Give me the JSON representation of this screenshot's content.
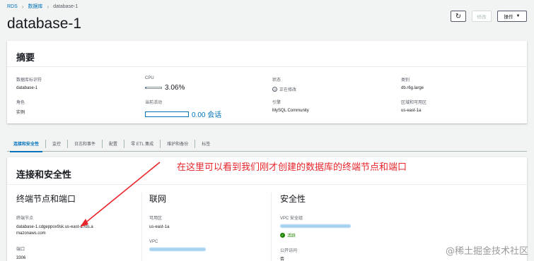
{
  "breadcrumb": {
    "root": "RDS",
    "section": "数据库",
    "current": "database-1"
  },
  "page": {
    "title": "database-1"
  },
  "toolbar": {
    "refresh_glyph": "↻",
    "modify_label": "修改",
    "actions_label": "操作",
    "actions_caret": "▼"
  },
  "summary": {
    "title": "摘要",
    "db_identifier": {
      "label": "数据库标识符",
      "value": "database-1"
    },
    "cpu": {
      "label": "CPU",
      "value": "3.06%",
      "fraction": 0.0306
    },
    "status": {
      "label": "状态",
      "value": "正在修改"
    },
    "class": {
      "label": "类别",
      "value": "db.r6g.large"
    },
    "role": {
      "label": "角色",
      "value": "实例"
    },
    "connections": {
      "label": "当前活动",
      "value": "0.00 会话"
    },
    "engine": {
      "label": "引擎",
      "value": "MySQL Community"
    },
    "region_az": {
      "label": "区域和可用区",
      "value": "us-east-1a"
    }
  },
  "tabs": [
    {
      "label": "连接和安全性",
      "active": true
    },
    {
      "label": "监控"
    },
    {
      "label": "日志和事件"
    },
    {
      "label": "配置"
    },
    {
      "label": "零 ETL 集成"
    },
    {
      "label": "维护和备份"
    },
    {
      "label": "标签"
    }
  ],
  "connectivity": {
    "title": "连接和安全性",
    "endpoint_section": {
      "heading": "终端节点和端口",
      "endpoint_label": "终端节点",
      "endpoint_value": "database-1.cdgeppox9sk.us-east-1.rds.amazonaws.com",
      "port_label": "端口",
      "port_value": "3306"
    },
    "network_section": {
      "heading": "联网",
      "az_label": "可用区",
      "az_value": "us-east-1a",
      "vpc_label": "VPC"
    },
    "security_section": {
      "heading": "安全性",
      "sg_label": "VPC 安全组",
      "sg_status": "活跃",
      "public_label": "公开访问",
      "public_value": "否"
    }
  },
  "annotation": {
    "text": "在这里可以看到我们刚才创建的数据库的终端节点和端口",
    "color": "#e8262c"
  },
  "watermark": {
    "text": "@稀土掘金技术社区"
  },
  "colors": {
    "link": "#0073bb",
    "background": "#f2f3f3",
    "success": "#1d8102"
  }
}
